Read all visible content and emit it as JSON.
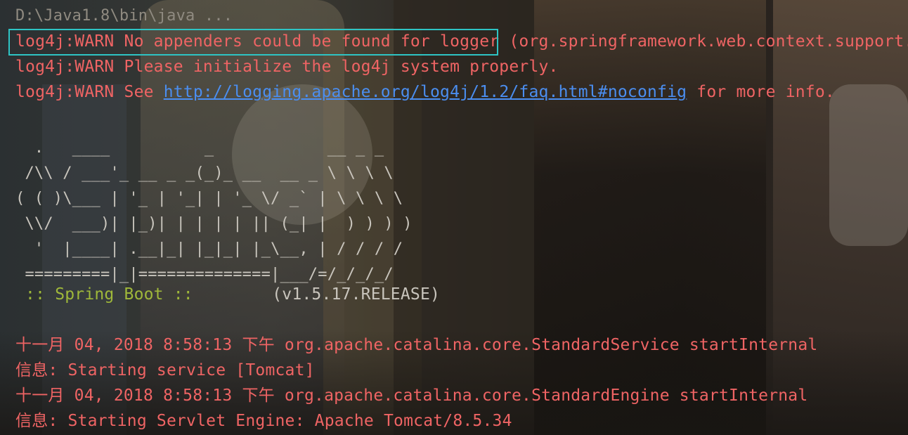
{
  "console": {
    "command": "D:\\Java1.8\\bin\\java ...",
    "warn_lines": [
      {
        "prefix": "log4j:WARN No appenders could be found for logger",
        "suffix": " (org.springframework.web.context.support."
      },
      {
        "text": "log4j:WARN Please initialize the log4j system properly."
      },
      {
        "before": "log4j:WARN See ",
        "link": "http://logging.apache.org/log4j/1.2/faq.html#noconfig",
        "after": " for more info."
      }
    ],
    "banner": [
      "  .   ____          _            __ _ _",
      " /\\\\ / ___'_ __ _ _(_)_ __  __ _ \\ \\ \\ \\",
      "( ( )\\___ | '_ | '_| | '_ \\/ _` | \\ \\ \\ \\",
      " \\\\/  ___)| |_)| | | | | || (_| |  ) ) ) )",
      "  '  |____| .__|_| |_|_| |_\\__, | / / / /",
      " =========|_|==============|___/=/_/_/_/"
    ],
    "spring_label": " :: Spring Boot :: ",
    "spring_version": "       (v1.5.17.RELEASE)",
    "log_lines": [
      "十一月 04, 2018 8:58:13 下午 org.apache.catalina.core.StandardService startInternal",
      "信息: Starting service [Tomcat]",
      "十一月 04, 2018 8:58:13 下午 org.apache.catalina.core.StandardEngine startInternal",
      "信息: Starting Servlet Engine: Apache Tomcat/8.5.34"
    ]
  },
  "colors": {
    "warn": "#ef6464",
    "link": "#4b8ef0",
    "highlight_border": "#2ec4c4",
    "spring_label": "#9fb83a"
  }
}
